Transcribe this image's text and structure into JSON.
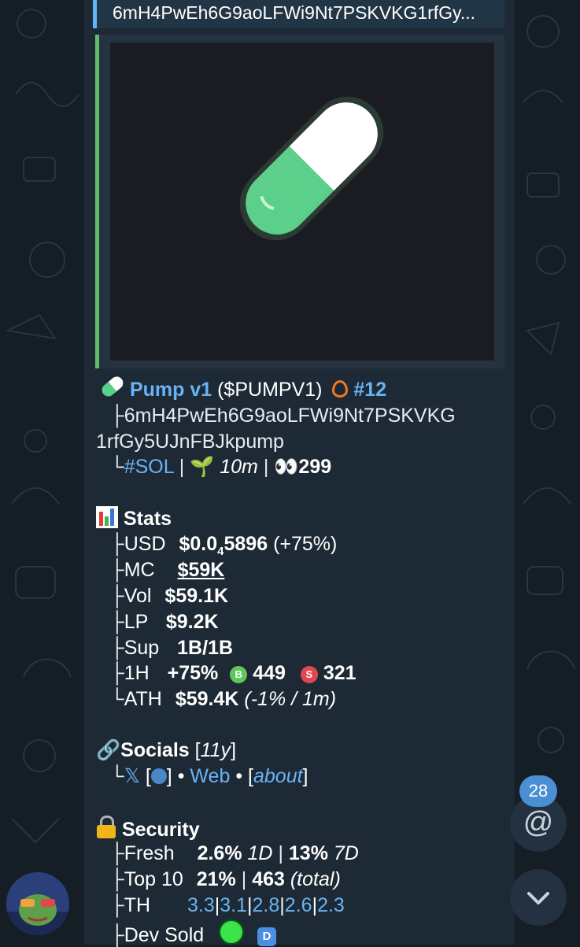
{
  "quote": {
    "text": "6mH4PwEh6G9aoLFWi9Nt7PSKVKG1rfGy..."
  },
  "token": {
    "icon": "pill-emoji",
    "name": "Pump v1",
    "ticker": "($PUMPV1)",
    "rank_icon": "fire-icon",
    "rank": "#12",
    "address_line1": "6mH4PwEh6G9aoLFWi9Nt7PSKVKG",
    "address_line2": "1rfGy5UJnFBJkpump",
    "chain": "#SOL",
    "age_icon": "seedling-icon",
    "age": "10m",
    "views_icon": "eyes-icon",
    "views": "299"
  },
  "stats": {
    "title": "Stats",
    "usd_label": "USD",
    "usd_value_prefix": "$0.0",
    "usd_value_sub": "4",
    "usd_value_suffix": "5896",
    "usd_change": "(+75%)",
    "mc_label": "MC",
    "mc_value": "$59K",
    "vol_label": "Vol",
    "vol_value": "$59.1K",
    "lp_label": "LP",
    "lp_value": "$9.2K",
    "sup_label": "Sup",
    "sup_value": "1B/1B",
    "h1_label": "1H",
    "h1_change": "+75%",
    "buy_badge": "B",
    "buys": "449",
    "sell_badge": "S",
    "sells": "321",
    "ath_label": "ATH",
    "ath_value": "$59.4K",
    "ath_detail": "(-1% / 1m)"
  },
  "socials": {
    "title": "Socials",
    "age_open": "[",
    "age": "11y",
    "age_close": "]",
    "x_link": "𝕏",
    "x_badge_open": "[",
    "x_badge_close": "]",
    "bullet1": "•",
    "web_link": "Web",
    "bullet2": "•",
    "about_open": "[",
    "about_link": "about",
    "about_close": "]"
  },
  "security": {
    "title": "Security",
    "fresh_label": "Fresh",
    "fresh_1d": "2.6%",
    "fresh_1d_unit": "1D",
    "fresh_7d": "13%",
    "fresh_7d_unit": "7D",
    "top10_label": "Top 10",
    "top10_pct": "21%",
    "top10_total": "463",
    "top10_total_unit": "(total)",
    "th_label": "TH",
    "th_values": [
      "3.3",
      "3.1",
      "2.8",
      "2.6",
      "2.3"
    ],
    "dev_label": "Dev Sold",
    "dev_badge": "D"
  },
  "sidebar": {
    "mention_count": "28",
    "mention_symbol": "@"
  },
  "colors": {
    "link": "#6ab3f3",
    "bubble": "#1d2a36",
    "background": "#151d25",
    "buy": "#5cc85a",
    "sell": "#e2474d"
  }
}
